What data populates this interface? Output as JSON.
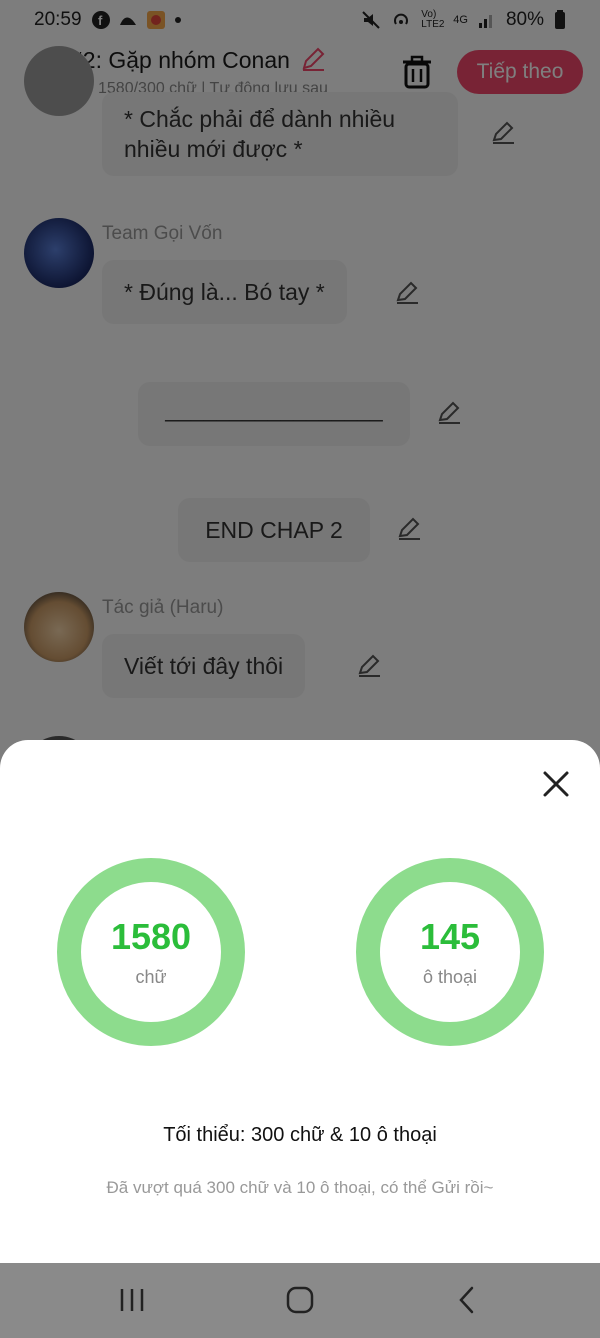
{
  "status_bar": {
    "time": "20:59",
    "left_icons": [
      "facebook-icon",
      "app-icon",
      "game-icon",
      "dot-icon"
    ],
    "right_icons": [
      "mute-icon",
      "hotspot-icon",
      "volte-icon",
      "4g-icon",
      "signal-icon"
    ],
    "network_volte": "Vo) LTE2",
    "network_4g": "4G",
    "battery": "80%"
  },
  "header": {
    "title": "#2: Gặp nhóm Conan",
    "subtitle": "1580/300 chữ | Tự động lưu sau",
    "next_label": "Tiếp theo",
    "accent_color": "#f0466a"
  },
  "messages": [
    {
      "speaker": "",
      "text": "* Chắc phải để dành nhiều nhiều mới được *"
    },
    {
      "speaker": "Team Gọi Vốn",
      "text": "* Đúng là... Bó tay *"
    },
    {
      "speaker": "",
      "text": "_________________"
    },
    {
      "speaker": "",
      "text": "END CHAP 2"
    },
    {
      "speaker": "Tác giả (Haru)",
      "text": "Viết tới đây thôi"
    }
  ],
  "sheet": {
    "words_count": "1580",
    "words_unit": "chữ",
    "dialogs_count": "145",
    "dialogs_unit": "ô thoại",
    "minimum": "Tối thiểu: 300 chữ & 10 ô thoại",
    "hint": "Đã vượt quá 300 chữ và 10 ô thoại, có thể Gửi rồi~",
    "ring_color": "#8ddc8d",
    "number_color": "#2bbd3a"
  },
  "nav_bar": {
    "buttons": [
      "recent-apps-icon",
      "home-icon",
      "back-icon"
    ]
  }
}
